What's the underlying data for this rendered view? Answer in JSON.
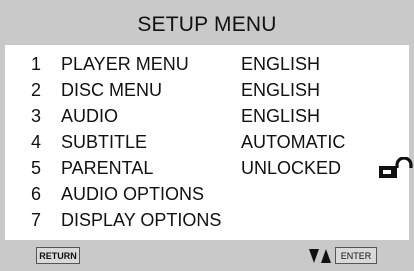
{
  "header": {
    "title": "SETUP MENU"
  },
  "menu": {
    "items": [
      {
        "num": "1",
        "label": "PLAYER MENU",
        "value": "ENGLISH"
      },
      {
        "num": "2",
        "label": "DISC MENU",
        "value": "ENGLISH"
      },
      {
        "num": "3",
        "label": "AUDIO",
        "value": "ENGLISH"
      },
      {
        "num": "4",
        "label": "SUBTITLE",
        "value": "AUTOMATIC"
      },
      {
        "num": "5",
        "label": "PARENTAL",
        "value": "UNLOCKED",
        "icon": "unlocked-padlock-icon"
      },
      {
        "num": "6",
        "label": "AUDIO OPTIONS",
        "value": ""
      },
      {
        "num": "7",
        "label": "DISPLAY OPTIONS",
        "value": ""
      }
    ]
  },
  "footer": {
    "return_label": "RETURN",
    "enter_label": "ENTER",
    "nav_icon": "up-down-arrows-icon"
  },
  "colors": {
    "frame": "#c9c9c9",
    "panel": "#ffffff",
    "text": "#111111"
  }
}
